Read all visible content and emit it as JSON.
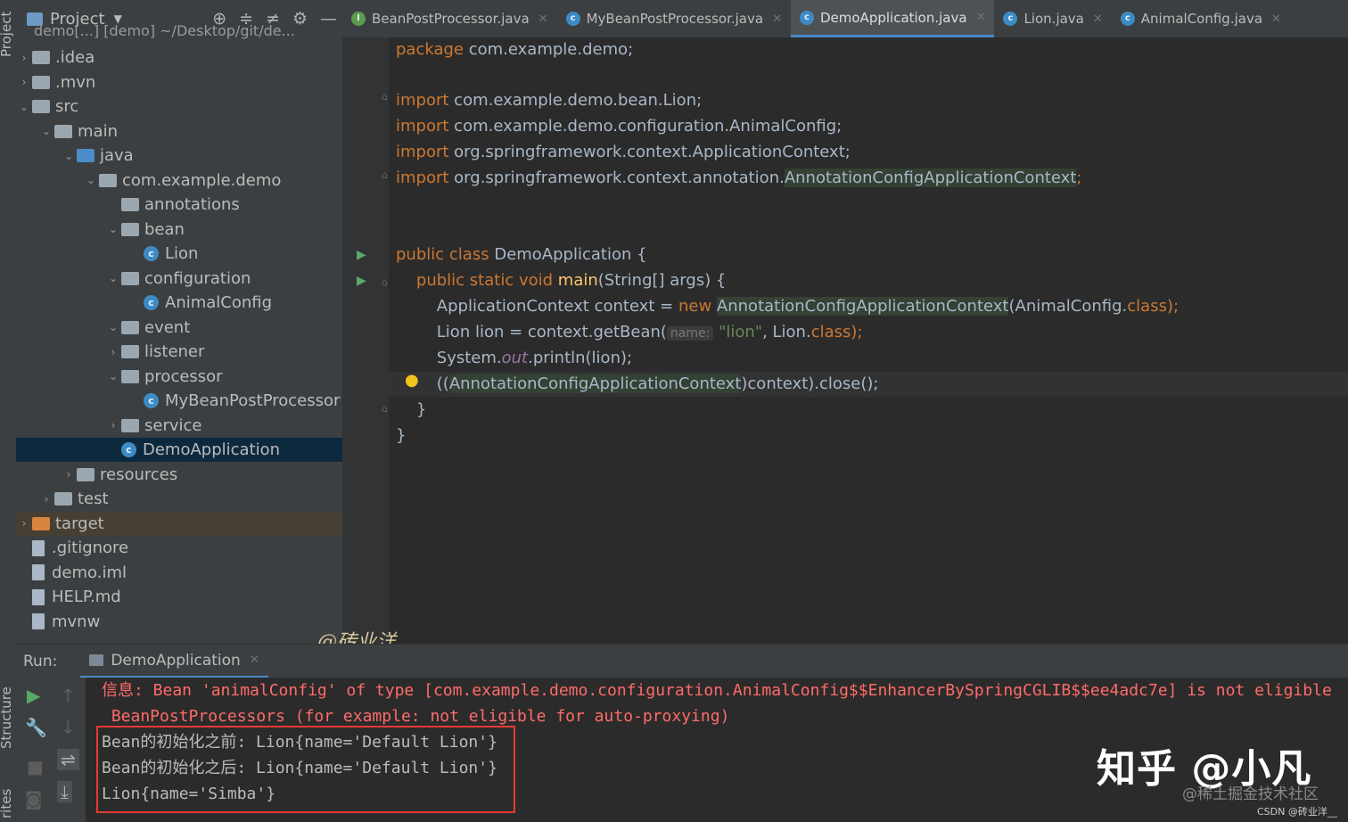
{
  "left_stripe": {
    "project": "Project",
    "structure": "Structure",
    "favorites": "rites"
  },
  "project_panel": {
    "title": "Project",
    "root_partial": "demo[...] [demo] ~/Desktop/git/de...",
    "tools": [
      "crosshair-icon",
      "expand-all-icon",
      "collapse-all-icon",
      "gear-icon",
      "minimize-icon"
    ],
    "tree": [
      {
        "label": ".idea",
        "depth": 0,
        "kind": "folder",
        "chev": ">"
      },
      {
        "label": ".mvn",
        "depth": 0,
        "kind": "folder",
        "chev": ">"
      },
      {
        "label": "src",
        "depth": 0,
        "kind": "folder",
        "chev": "v"
      },
      {
        "label": "main",
        "depth": 1,
        "kind": "folder",
        "chev": "v"
      },
      {
        "label": "java",
        "depth": 2,
        "kind": "folder-blue",
        "chev": "v"
      },
      {
        "label": "com.example.demo",
        "depth": 3,
        "kind": "package",
        "chev": "v"
      },
      {
        "label": "annotations",
        "depth": 4,
        "kind": "package",
        "chev": ""
      },
      {
        "label": "bean",
        "depth": 4,
        "kind": "package",
        "chev": "v"
      },
      {
        "label": "Lion",
        "depth": 5,
        "kind": "class",
        "chev": ""
      },
      {
        "label": "configuration",
        "depth": 4,
        "kind": "package",
        "chev": "v"
      },
      {
        "label": "AnimalConfig",
        "depth": 5,
        "kind": "class",
        "chev": ""
      },
      {
        "label": "event",
        "depth": 4,
        "kind": "package",
        "chev": "v"
      },
      {
        "label": "listener",
        "depth": 4,
        "kind": "package",
        "chev": ">"
      },
      {
        "label": "processor",
        "depth": 4,
        "kind": "package",
        "chev": "v"
      },
      {
        "label": "MyBeanPostProcessor",
        "depth": 5,
        "kind": "class",
        "chev": ""
      },
      {
        "label": "service",
        "depth": 4,
        "kind": "package",
        "chev": ">"
      },
      {
        "label": "DemoApplication",
        "depth": 4,
        "kind": "class",
        "chev": "",
        "selected": true
      },
      {
        "label": "resources",
        "depth": 2,
        "kind": "folder",
        "chev": ">"
      },
      {
        "label": "test",
        "depth": 1,
        "kind": "folder",
        "chev": ">"
      },
      {
        "label": "target",
        "depth": 0,
        "kind": "folder-orange",
        "chev": ">",
        "excluded": true
      },
      {
        "label": ".gitignore",
        "depth": 0,
        "kind": "file",
        "chev": ""
      },
      {
        "label": "demo.iml",
        "depth": 0,
        "kind": "file",
        "chev": ""
      },
      {
        "label": "HELP.md",
        "depth": 0,
        "kind": "file",
        "chev": ""
      },
      {
        "label": "mvnw",
        "depth": 0,
        "kind": "file",
        "chev": ""
      }
    ]
  },
  "tabs": [
    {
      "label": "BeanPostProcessor.java",
      "icon": "interface-icon",
      "active": false
    },
    {
      "label": "MyBeanPostProcessor.java",
      "icon": "class-icon",
      "active": false
    },
    {
      "label": "DemoApplication.java",
      "icon": "class-icon",
      "active": true
    },
    {
      "label": "Lion.java",
      "icon": "class-icon",
      "active": false
    },
    {
      "label": "AnimalConfig.java",
      "icon": "class-icon",
      "active": false
    }
  ],
  "code": {
    "package_kw": "package",
    "package_name": "com.example.demo;",
    "import_kw": "import",
    "imports": [
      "com.example.demo.bean.Lion;",
      "com.example.demo.configuration.AnimalConfig;",
      "org.springframework.context.ApplicationContext;"
    ],
    "import4_prefix": "org.springframework.context.annotation.",
    "import4_class": "AnnotationConfigApplicationContext",
    "import4_suffix": ";",
    "public_kw": "public",
    "class_kw": "class",
    "class_name": "DemoApplication {",
    "static_kw": "static",
    "void_kw": "void",
    "main_fn": "main",
    "main_args": "(String[] args) {",
    "ctx_decl": "ApplicationContext context = ",
    "new_kw": "new",
    "ctx_class": "AnnotationConfigApplicationContext",
    "ctx_args": "(AnimalConfig.",
    "class_dot_kw": "class",
    "ctx_end": ");",
    "lion_decl": "Lion lion = context.getBean(",
    "hint_name": "name:",
    "lion_str": "\"lion\"",
    "lion_args": ", Lion.",
    "lion_end": ");",
    "sys_prefix": "System.",
    "sys_out": "out",
    "sys_suffix": ".println(lion);",
    "close_open": "((",
    "close_class": "AnnotationConfigApplicationContext",
    "close_suffix": ")context).close();",
    "brace_inner": "}",
    "brace_outer": "}"
  },
  "watermark_author": "@砖业洋__",
  "run": {
    "label": "Run:",
    "tab": "DemoApplication",
    "console": [
      {
        "text": "信息: Bean 'animalConfig' of type [com.example.demo.configuration.AnimalConfig$$EnhancerBySpringCGLIB$$ee4adc7e] is not eligible",
        "kind": "err"
      },
      {
        "text": " BeanPostProcessors (for example: not eligible for auto-proxying)",
        "kind": "err"
      },
      {
        "text": "Bean的初始化之前: Lion{name='Default Lion'}",
        "kind": "out"
      },
      {
        "text": "Bean的初始化之后: Lion{name='Default Lion'}",
        "kind": "out"
      },
      {
        "text": "Lion{name='Simba'}",
        "kind": "out"
      }
    ]
  },
  "watermarks": {
    "zhihu": "知乎 @小凡",
    "juejin": "@稀土掘金技术社区",
    "csdn": "CSDN @砖业洋__"
  },
  "colors": {
    "keyword": "#cc7832",
    "string": "#6a8759",
    "error": "#ff6b68",
    "selection": "#0d293e",
    "accent": "#4a88c7"
  }
}
